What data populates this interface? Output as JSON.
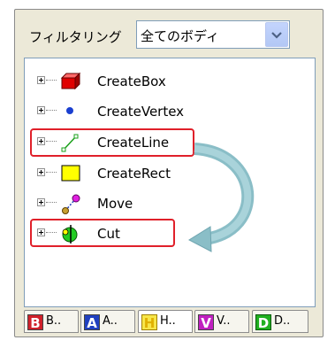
{
  "filter": {
    "label": "フィルタリング",
    "selected": "全てのボディ"
  },
  "tree_items": [
    {
      "label": "CreateBox",
      "icon": "box-icon"
    },
    {
      "label": "CreateVertex",
      "icon": "vertex-icon"
    },
    {
      "label": "CreateLine",
      "icon": "line-icon"
    },
    {
      "label": "CreateRect",
      "icon": "rect-icon"
    },
    {
      "label": "Move",
      "icon": "move-icon"
    },
    {
      "label": "Cut",
      "icon": "cut-icon"
    }
  ],
  "tabs": [
    {
      "glyph": "B",
      "label": "B..",
      "color": "#d0202a"
    },
    {
      "glyph": "A",
      "label": "A..",
      "color": "#2040c0"
    },
    {
      "glyph": "H",
      "label": "H..",
      "color": "#f0d000"
    },
    {
      "glyph": "V",
      "label": "V..",
      "color": "#c020c0"
    },
    {
      "glyph": "D",
      "label": "D..",
      "color": "#20b020"
    }
  ],
  "colors": {
    "highlight": "#e0202a",
    "arrow": "#7fb5c0"
  }
}
